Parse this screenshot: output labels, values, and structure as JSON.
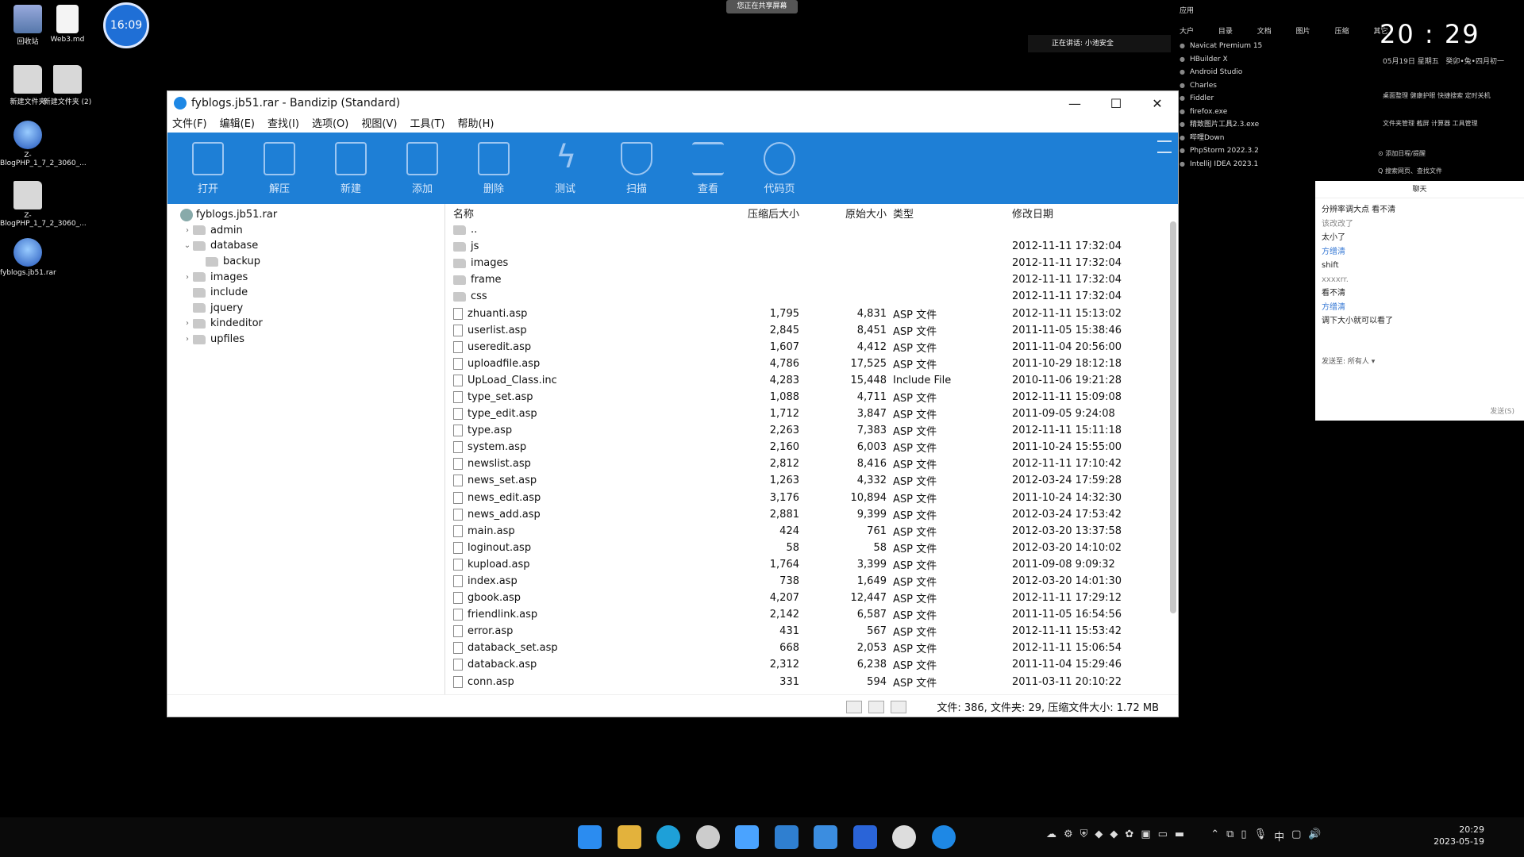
{
  "desktop": {
    "icons": [
      {
        "label": "回收站"
      },
      {
        "label": "Web3.md"
      },
      {
        "label": "新建文件夹"
      },
      {
        "label": "新建文件夹 (2)"
      },
      {
        "label": "Z-BlogPHP_1_7_2_3060_..."
      },
      {
        "label": "Z-BlogPHP_1_7_2_3060_..."
      },
      {
        "label": "fyblogs.jb51.rar"
      }
    ],
    "clock_badge": "16:09",
    "share_banner": "您正在共享屏幕",
    "speaking": "正在讲话: 小池安全"
  },
  "right_panel": {
    "label": "应用",
    "categories": [
      "大户",
      "目录",
      "文档",
      "图片",
      "压缩",
      "其它"
    ],
    "apps": [
      "Navicat Premium 15",
      "HBuilder X",
      "Android Studio",
      "Charles",
      "Fiddler",
      "firefox.exe",
      "精致图片工具2.3.exe",
      "哔哩Down",
      "PhpStorm 2022.3.2",
      "IntelliJ IDEA 2023.1"
    ],
    "time": "20 : 29",
    "date": "05月19日   星期五",
    "lunar": "癸卯•兔•四月初一",
    "quick1": "桌面整理   健康护眼   快捷搜索   定时关机",
    "quick2": "文件夹管理   截屏   计算器   工具管理",
    "tip": "⊙ 添加日程/提醒",
    "search": "Q 搜索网页、查找文件"
  },
  "chat": {
    "title": "聊天",
    "messages": [
      {
        "text": "分辨率调大点  看不清",
        "style": ""
      },
      {
        "text": "该改改了",
        "style": "grey"
      },
      {
        "text": "太小了",
        "style": ""
      },
      {
        "text": "方缯清",
        "style": "blue"
      },
      {
        "text": "shift",
        "style": ""
      },
      {
        "text": "xxxxrr.",
        "style": "grey"
      },
      {
        "text": "看不清",
        "style": ""
      },
      {
        "text": "方缯清",
        "style": "blue"
      },
      {
        "text": "调下大小就可以看了",
        "style": ""
      }
    ],
    "compose_label": "发送至:   所有人 ▾",
    "send": "发送(S)"
  },
  "window": {
    "title": "fyblogs.jb51.rar - Bandizip (Standard)",
    "menu": [
      "文件(F)",
      "编辑(E)",
      "查找(I)",
      "选项(O)",
      "视图(V)",
      "工具(T)",
      "帮助(H)"
    ],
    "toolbar": [
      "打开",
      "解压",
      "新建",
      "添加",
      "删除",
      "测试",
      "扫描",
      "查看",
      "代码页"
    ],
    "tree": [
      {
        "label": "fyblogs.jb51.rar",
        "indent": 0,
        "arrow": "",
        "root": true
      },
      {
        "label": "admin",
        "indent": 1,
        "arrow": "›"
      },
      {
        "label": "database",
        "indent": 1,
        "arrow": "⌄"
      },
      {
        "label": "backup",
        "indent": 2,
        "arrow": ""
      },
      {
        "label": "images",
        "indent": 1,
        "arrow": "›"
      },
      {
        "label": "include",
        "indent": 1,
        "arrow": ""
      },
      {
        "label": "jquery",
        "indent": 1,
        "arrow": ""
      },
      {
        "label": "kindeditor",
        "indent": 1,
        "arrow": "›"
      },
      {
        "label": "upfiles",
        "indent": 1,
        "arrow": "›"
      }
    ],
    "columns": {
      "name": "名称",
      "compressed": "压缩后大小",
      "original": "原始大小",
      "type": "类型",
      "date": "修改日期"
    },
    "files": [
      {
        "name": "..",
        "c": "",
        "o": "",
        "t": "",
        "d": "",
        "folder": true
      },
      {
        "name": "js",
        "c": "",
        "o": "",
        "t": "",
        "d": "2012-11-11 17:32:04",
        "folder": true
      },
      {
        "name": "images",
        "c": "",
        "o": "",
        "t": "",
        "d": "2012-11-11 17:32:04",
        "folder": true
      },
      {
        "name": "frame",
        "c": "",
        "o": "",
        "t": "",
        "d": "2012-11-11 17:32:04",
        "folder": true
      },
      {
        "name": "css",
        "c": "",
        "o": "",
        "t": "",
        "d": "2012-11-11 17:32:04",
        "folder": true
      },
      {
        "name": "zhuanti.asp",
        "c": "1,795",
        "o": "4,831",
        "t": "ASP 文件",
        "d": "2012-11-11 15:13:02"
      },
      {
        "name": "userlist.asp",
        "c": "2,845",
        "o": "8,451",
        "t": "ASP 文件",
        "d": "2011-11-05 15:38:46"
      },
      {
        "name": "useredit.asp",
        "c": "1,607",
        "o": "4,412",
        "t": "ASP 文件",
        "d": "2011-11-04 20:56:00"
      },
      {
        "name": "uploadfile.asp",
        "c": "4,786",
        "o": "17,525",
        "t": "ASP 文件",
        "d": "2011-10-29 18:12:18"
      },
      {
        "name": "UpLoad_Class.inc",
        "c": "4,283",
        "o": "15,448",
        "t": "Include File",
        "d": "2010-11-06 19:21:28"
      },
      {
        "name": "type_set.asp",
        "c": "1,088",
        "o": "4,711",
        "t": "ASP 文件",
        "d": "2012-11-11 15:09:08"
      },
      {
        "name": "type_edit.asp",
        "c": "1,712",
        "o": "3,847",
        "t": "ASP 文件",
        "d": "2011-09-05 9:24:08"
      },
      {
        "name": "type.asp",
        "c": "2,263",
        "o": "7,383",
        "t": "ASP 文件",
        "d": "2012-11-11 15:11:18"
      },
      {
        "name": "system.asp",
        "c": "2,160",
        "o": "6,003",
        "t": "ASP 文件",
        "d": "2011-10-24 15:55:00"
      },
      {
        "name": "newslist.asp",
        "c": "2,812",
        "o": "8,416",
        "t": "ASP 文件",
        "d": "2012-11-11 17:10:42"
      },
      {
        "name": "news_set.asp",
        "c": "1,263",
        "o": "4,332",
        "t": "ASP 文件",
        "d": "2012-03-24 17:59:28"
      },
      {
        "name": "news_edit.asp",
        "c": "3,176",
        "o": "10,894",
        "t": "ASP 文件",
        "d": "2011-10-24 14:32:30"
      },
      {
        "name": "news_add.asp",
        "c": "2,881",
        "o": "9,399",
        "t": "ASP 文件",
        "d": "2012-03-24 17:53:42"
      },
      {
        "name": "main.asp",
        "c": "424",
        "o": "761",
        "t": "ASP 文件",
        "d": "2012-03-20 13:37:58"
      },
      {
        "name": "loginout.asp",
        "c": "58",
        "o": "58",
        "t": "ASP 文件",
        "d": "2012-03-20 14:10:02"
      },
      {
        "name": "kupload.asp",
        "c": "1,764",
        "o": "3,399",
        "t": "ASP 文件",
        "d": "2011-09-08 9:09:32"
      },
      {
        "name": "index.asp",
        "c": "738",
        "o": "1,649",
        "t": "ASP 文件",
        "d": "2012-03-20 14:01:30"
      },
      {
        "name": "gbook.asp",
        "c": "4,207",
        "o": "12,447",
        "t": "ASP 文件",
        "d": "2012-11-11 17:29:12"
      },
      {
        "name": "friendlink.asp",
        "c": "2,142",
        "o": "6,587",
        "t": "ASP 文件",
        "d": "2011-11-05 16:54:56"
      },
      {
        "name": "error.asp",
        "c": "431",
        "o": "567",
        "t": "ASP 文件",
        "d": "2012-11-11 15:53:42"
      },
      {
        "name": "databack_set.asp",
        "c": "668",
        "o": "2,053",
        "t": "ASP 文件",
        "d": "2012-11-11 15:06:54"
      },
      {
        "name": "databack.asp",
        "c": "2,312",
        "o": "6,238",
        "t": "ASP 文件",
        "d": "2011-11-04 15:29:46"
      },
      {
        "name": "conn.asp",
        "c": "331",
        "o": "594",
        "t": "ASP 文件",
        "d": "2011-03-11 20:10:22"
      }
    ],
    "status": "文件: 386, 文件夹: 29, 压缩文件大小: 1.72 MB"
  },
  "taskbar": {
    "time": "20:29",
    "date": "2023-05-19",
    "tray_lang": "中"
  }
}
